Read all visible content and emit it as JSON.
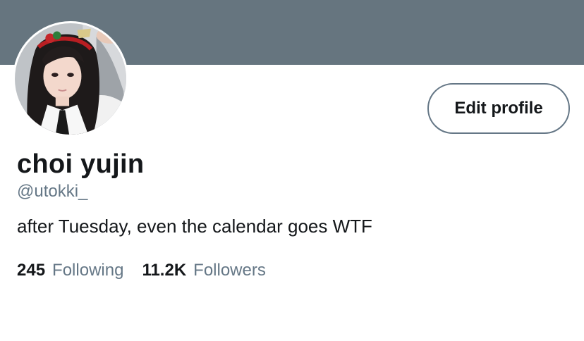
{
  "profile": {
    "display_name": "choi yujin",
    "handle": "@utokki_",
    "bio": "after Tuesday, even the calendar goes WTF",
    "edit_button_label": "Edit profile",
    "banner_color": "#66757f"
  },
  "stats": {
    "following_count": "245",
    "following_label": "Following",
    "followers_count": "11.2K",
    "followers_label": "Followers"
  },
  "colors": {
    "text_primary": "#14171a",
    "text_secondary": "#657786"
  }
}
